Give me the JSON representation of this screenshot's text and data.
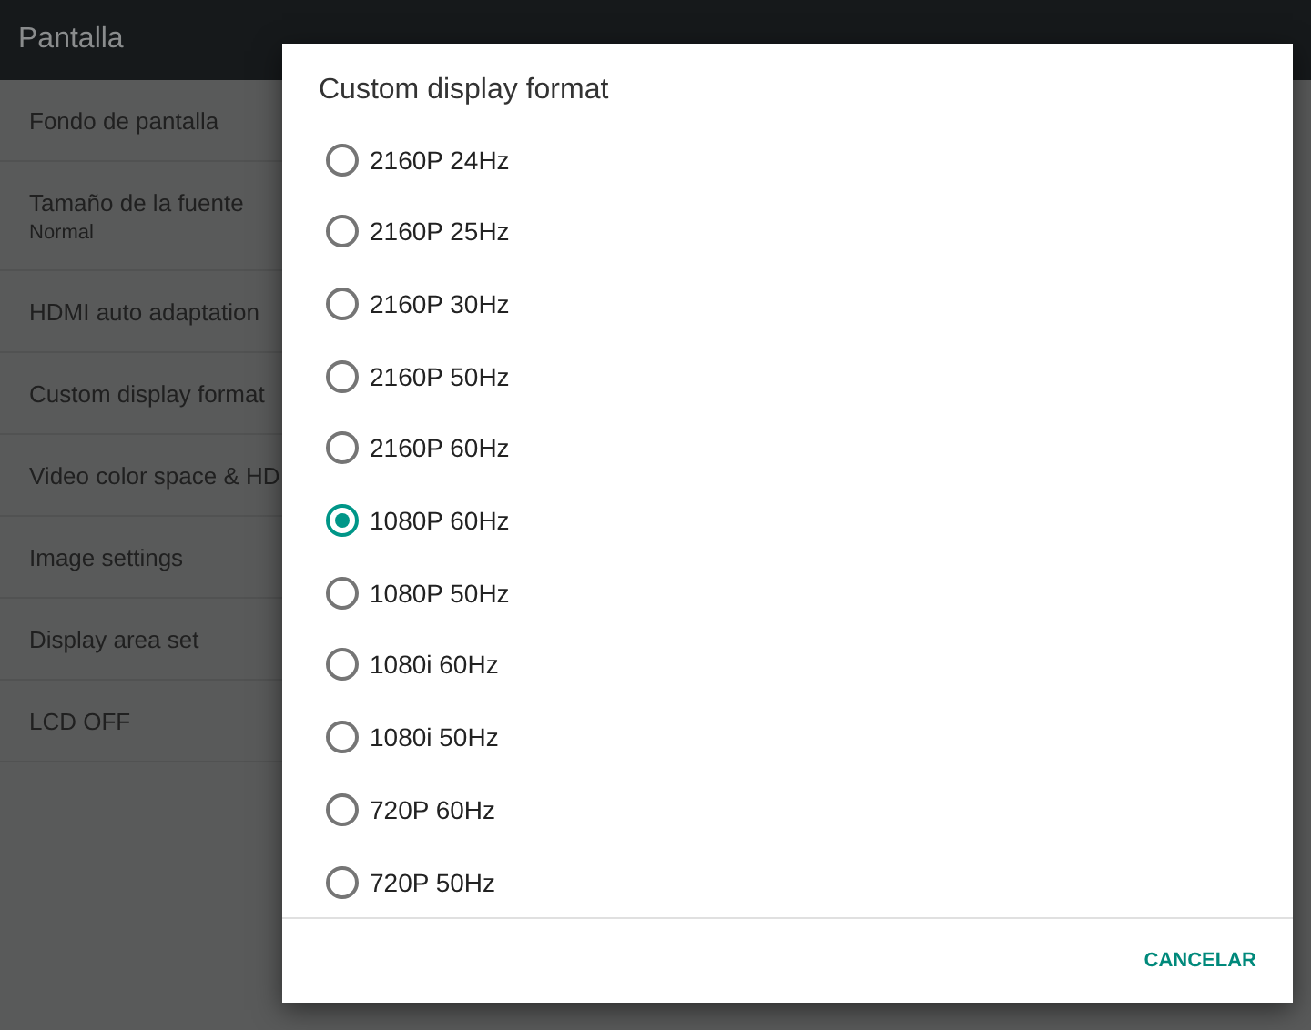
{
  "app_bar": {
    "title": "Pantalla"
  },
  "settings": [
    {
      "label": "Fondo de pantalla"
    },
    {
      "label": "Tamaño de la fuente",
      "summary": "Normal"
    },
    {
      "label": "HDMI auto adaptation"
    },
    {
      "label": "Custom display format"
    },
    {
      "label": "Video color space & HD"
    },
    {
      "label": "Image settings"
    },
    {
      "label": "Display area set"
    },
    {
      "label": "LCD OFF"
    }
  ],
  "dialog": {
    "title": "Custom display format",
    "options": [
      {
        "label": "2160P 24Hz",
        "selected": false
      },
      {
        "label": "2160P 25Hz",
        "selected": false
      },
      {
        "label": "2160P 30Hz",
        "selected": false
      },
      {
        "label": "2160P 50Hz",
        "selected": false
      },
      {
        "label": "2160P 60Hz",
        "selected": false
      },
      {
        "label": "1080P 60Hz",
        "selected": true
      },
      {
        "label": "1080P 50Hz",
        "selected": false
      },
      {
        "label": "1080i 60Hz",
        "selected": false
      },
      {
        "label": "1080i 50Hz",
        "selected": false
      },
      {
        "label": "720P 60Hz",
        "selected": false
      },
      {
        "label": "720P 50Hz",
        "selected": false
      }
    ],
    "buttons": [
      "CANCELAR"
    ]
  }
}
